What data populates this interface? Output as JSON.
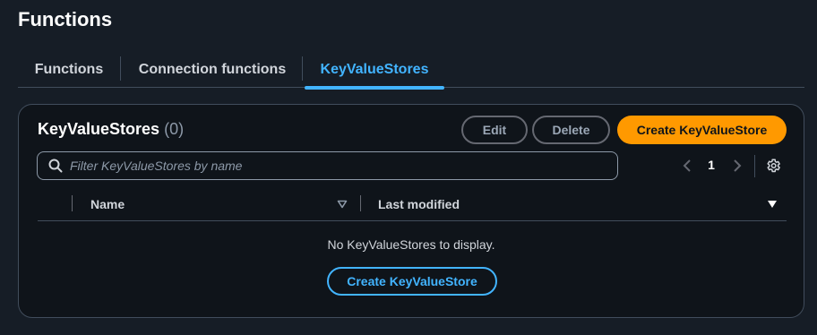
{
  "page": {
    "title": "Functions"
  },
  "tabs": [
    {
      "label": "Functions"
    },
    {
      "label": "Connection functions"
    },
    {
      "label": "KeyValueStores"
    }
  ],
  "active_tab": "KeyValueStores",
  "container": {
    "title": "KeyValueStores",
    "count": "(0)",
    "actions": {
      "edit_label": "Edit",
      "delete_label": "Delete",
      "create_label": "Create KeyValueStore"
    }
  },
  "search": {
    "placeholder": "Filter KeyValueStores by name",
    "value": ""
  },
  "pagination": {
    "current_page": "1"
  },
  "table": {
    "columns": [
      {
        "label": "Name"
      },
      {
        "label": "Last modified"
      }
    ],
    "empty_text": "No KeyValueStores to display.",
    "empty_action_label": "Create KeyValueStore"
  },
  "icons": {
    "search": "search-icon",
    "prev": "chevron-left-icon",
    "next": "chevron-right-icon",
    "settings": "gear-icon",
    "sort": "caret-down-icon"
  },
  "colors": {
    "background": "#161d26",
    "container": "#0f141a",
    "accent": "#42b4ff",
    "primary_button": "#ff9900",
    "border": "#414d5c"
  }
}
